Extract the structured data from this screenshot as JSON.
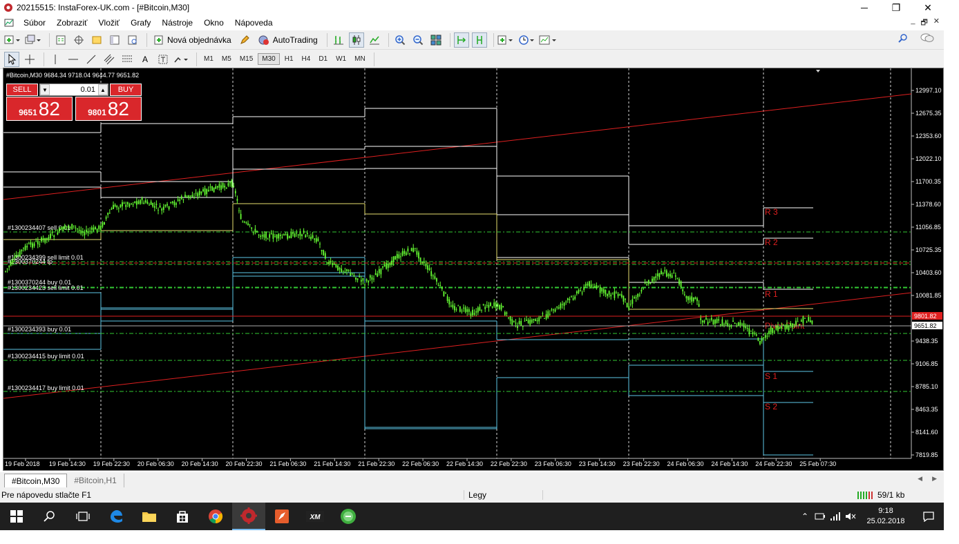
{
  "window": {
    "title": "20215515: InstaForex-UK.com - [#Bitcoin,M30]",
    "minimize": "─",
    "maximize": "❐",
    "close": "✕"
  },
  "menu": [
    "Súbor",
    "Zobraziť",
    "Vložiť",
    "Grafy",
    "Nástroje",
    "Okno",
    "Nápoveda"
  ],
  "toolbar": {
    "new_order": "Nová objednávka",
    "autotrading": "AutoTrading"
  },
  "timeframes": [
    "M1",
    "M5",
    "M15",
    "M30",
    "H1",
    "H4",
    "D1",
    "W1",
    "MN"
  ],
  "active_timeframe": "M30",
  "chart": {
    "header": "#Bitcoin,M30  9684.34 9718.04 9644.77 9651.82",
    "one_click": {
      "sell_label": "SELL",
      "buy_label": "BUY",
      "lot": "0.01",
      "sell_small": "9651",
      "sell_big": "82",
      "buy_small": "9801",
      "buy_big": "82"
    },
    "price_axis": [
      "12997.10",
      "12675.35",
      "12353.60",
      "12022.10",
      "11700.35",
      "11378.60",
      "11056.85",
      "10725.35",
      "10403.60",
      "10081.85",
      "9438.35",
      "9106.85",
      "8785.10",
      "8463.35",
      "8141.60",
      "7819.85"
    ],
    "ask_price": "9801.82",
    "bid_price": "9651.82",
    "time_axis": [
      "19 Feb 2018",
      "19 Feb 14:30",
      "19 Feb 22:30",
      "20 Feb 06:30",
      "20 Feb 14:30",
      "20 Feb 22:30",
      "21 Feb 06:30",
      "21 Feb 14:30",
      "21 Feb 22:30",
      "22 Feb 06:30",
      "22 Feb 14:30",
      "22 Feb 22:30",
      "23 Feb 06:30",
      "23 Feb 14:30",
      "23 Feb 22:30",
      "24 Feb 06:30",
      "24 Feb 14:30",
      "24 Feb 22:30",
      "25 Feb 07:30"
    ],
    "pivot_labels": [
      "R 3",
      "R 2",
      "R 1",
      "Pivot Point",
      "S 1",
      "S 2"
    ],
    "orders": [
      "#1300234407 sell 0.01",
      "#1300234399 sell limit 0.01",
      "#1300370244 tp",
      "#1300370244 buy 0.01",
      "#1300234423 sell limit 0.01",
      "#1300234393 buy 0.01",
      "#1300234415 buy limit 0.01",
      "#1300234417 buy limit 0.01"
    ],
    "colors": {
      "background": "#000000",
      "candles": "#66ff33",
      "pivot": "#ffffff",
      "support": "#5ec8e8",
      "trend": "#e02020",
      "order": "#33cc33"
    }
  },
  "tabs": [
    "#Bitcoin,M30",
    "#Bitcoin,H1"
  ],
  "status": {
    "help": "Pre nápovedu stlačte F1",
    "profile": "Legy",
    "connection": "59/1 kb"
  },
  "taskbar": {
    "time": "9:18",
    "date": "25.02.2018"
  }
}
